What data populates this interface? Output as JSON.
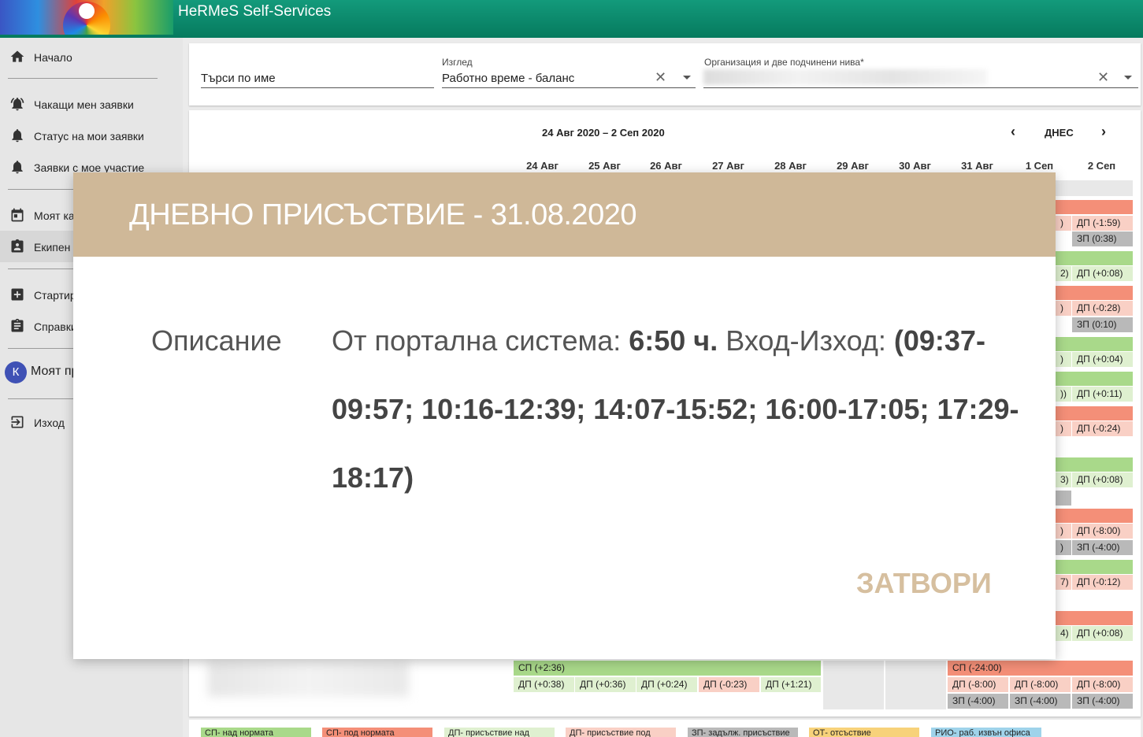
{
  "header": {
    "title": "HeRMeS Self-Services"
  },
  "sidebar": {
    "items": [
      {
        "label": "Начало",
        "icon": "home-icon"
      },
      {
        "label": "Чакащи мен заявки",
        "icon": "bell-ring-icon"
      },
      {
        "label": "Статус на мои заявки",
        "icon": "bell-icon"
      },
      {
        "label": "Заявки с мое участие",
        "icon": "bell-icon"
      },
      {
        "label": "Моят ка",
        "icon": "calendar-icon"
      },
      {
        "label": "Екипен",
        "icon": "contact-card-icon"
      },
      {
        "label": "Стартир",
        "icon": "plus-box-icon"
      },
      {
        "label": "Справки",
        "icon": "clipboard-icon"
      },
      {
        "label": "Моят пр",
        "icon": "avatar-icon",
        "avatar_letter": "К"
      },
      {
        "label": "Изход",
        "icon": "exit-icon"
      }
    ]
  },
  "filters": {
    "search": {
      "value": "Търси по име"
    },
    "view": {
      "label": "Изглед",
      "value": "Работно време - баланс"
    },
    "org": {
      "label": "Организация и две подчинени нива*"
    }
  },
  "calendar": {
    "range": "24 Авг 2020 – 2 Сеп 2020",
    "today": "ДНЕС",
    "prev": "‹",
    "next": "›",
    "days": [
      "24 Авг",
      "25 Авг",
      "26 Авг",
      "27 Авг",
      "28 Авг",
      "29 Авг",
      "30 Авг",
      "31 Авг",
      "1 Сеп",
      "2 Сеп"
    ],
    "visible_cells": {
      "c1": ")",
      "c2": "ДП (-1:59)",
      "c3": "ЗП (0:38)",
      "c4": "2)",
      "c5": "ДП (+0:08)",
      "c6": ")",
      "c7": "ДП (-0:28)",
      "c8": "ЗП (0:10)",
      "c9": ")",
      "c10": "ДП (+0:04)",
      "c11": "))",
      "c12": "ДП (+0:11)",
      "c13": ")",
      "c14": "ДП (-0:24)",
      "c15": "3)",
      "c16": "ДП (+0:08)",
      "c17": ")",
      "c18": "ДП (-8:00)",
      "c19": ")",
      "c20": "ЗП (-4:00)",
      "c21": "7)",
      "c22": "ДП (-0:12)",
      "c23": "4)",
      "c24": "ДП (+0:08)"
    },
    "bottom_row": {
      "sp": "СП (+2:36)",
      "sp_neg": "СП (-24:00)",
      "dp": [
        "ДП (+0:38)",
        "ДП (+0:36)",
        "ДП (+0:24)",
        "ДП (-0:23)",
        "ДП (+1:21)"
      ],
      "dp_right": [
        "ДП (-8:00)",
        "ДП (-8:00)",
        "ДП (-8:00)"
      ],
      "zp_right": [
        "ЗП (-4:00)",
        "ЗП (-4:00)",
        "ЗП (-4:00)"
      ]
    }
  },
  "legend": [
    {
      "label": "СП- над нормата",
      "color": "#a9d98a"
    },
    {
      "label": "СП- под нормата",
      "color": "#f48f78"
    },
    {
      "label": "ДП- присъствие над",
      "color": "#dff0d0"
    },
    {
      "label": "ДП- присъствие под",
      "color": "#f9d0c5"
    },
    {
      "label": "ЗП- задълж. присъствие",
      "color": "#b9b9b9"
    },
    {
      "label": "ОТ- отсъствие",
      "color": "#f7d27a"
    },
    {
      "label": "РИО- раб. извън офиса",
      "color": "#9fd3ea"
    }
  ],
  "modal": {
    "title": "ДНЕВНО ПРИСЪСТВИЕ - 31.08.2020",
    "desc_label": "Описание",
    "desc_prefix": "От портална система: ",
    "desc_hours": "6:50 ч.",
    "desc_mid": " Вход-Изход: ",
    "desc_times": "(09:37-09:57; 10:16-12:39; 14:07-15:52; 16:00-17:05; 17:29-18:17)",
    "close": "ЗАТВОРИ"
  }
}
